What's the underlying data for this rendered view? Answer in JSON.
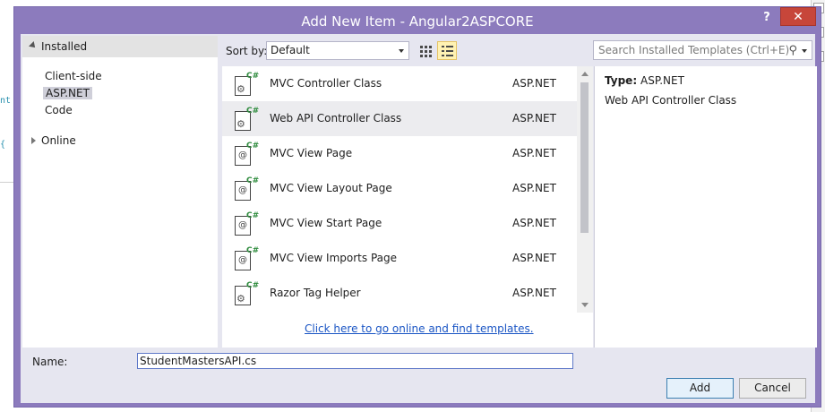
{
  "background": {
    "editor_fragments": [
      "nt",
      "{ "
    ],
    "scrollbar_indicators": 3
  },
  "dialog": {
    "title": "Add New Item - Angular2ASPCORE",
    "help_label": "?",
    "close_label": "✕"
  },
  "tree": {
    "header": "Installed",
    "items": [
      {
        "label": "Client-side",
        "selected": false
      },
      {
        "label": "ASP.NET",
        "selected": true
      },
      {
        "label": "Code",
        "selected": false
      }
    ],
    "online": "Online"
  },
  "toolbar": {
    "sort_by_label": "Sort by:",
    "sort_value": "Default",
    "search_placeholder": "Search Installed Templates (Ctrl+E)"
  },
  "templates": [
    {
      "name": "MVC Controller Class",
      "tag": "ASP.NET",
      "icon": "controller-template-icon",
      "selected": false
    },
    {
      "name": "Web API Controller Class",
      "tag": "ASP.NET",
      "icon": "controller-template-icon",
      "selected": true
    },
    {
      "name": "MVC View Page",
      "tag": "ASP.NET",
      "icon": "view-template-icon",
      "selected": false
    },
    {
      "name": "MVC View Layout Page",
      "tag": "ASP.NET",
      "icon": "view-template-icon",
      "selected": false
    },
    {
      "name": "MVC View Start Page",
      "tag": "ASP.NET",
      "icon": "view-template-icon",
      "selected": false
    },
    {
      "name": "MVC View Imports Page",
      "tag": "ASP.NET",
      "icon": "view-template-icon",
      "selected": false
    },
    {
      "name": "Razor Tag Helper",
      "tag": "ASP.NET",
      "icon": "controller-template-icon",
      "selected": false
    }
  ],
  "online_link": "Click here to go online and find templates.",
  "details": {
    "type_label": "Type:",
    "type_value": "ASP.NET",
    "description": "Web API Controller Class"
  },
  "name_field": {
    "label": "Name:",
    "value": "StudentMastersAPI.cs"
  },
  "buttons": {
    "add": "Add",
    "cancel": "Cancel"
  }
}
